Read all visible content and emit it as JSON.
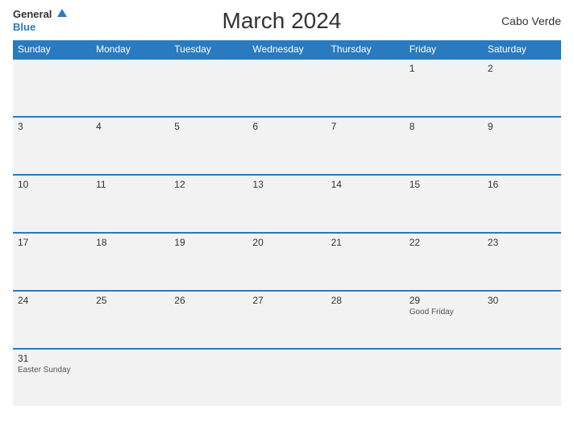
{
  "logo": {
    "general": "General",
    "blue": "Blue"
  },
  "title": "March 2024",
  "country": "Cabo Verde",
  "days": [
    "Sunday",
    "Monday",
    "Tuesday",
    "Wednesday",
    "Thursday",
    "Friday",
    "Saturday"
  ],
  "weeks": [
    [
      {
        "day": "",
        "event": ""
      },
      {
        "day": "",
        "event": ""
      },
      {
        "day": "",
        "event": ""
      },
      {
        "day": "",
        "event": ""
      },
      {
        "day": "",
        "event": ""
      },
      {
        "day": "1",
        "event": ""
      },
      {
        "day": "2",
        "event": ""
      }
    ],
    [
      {
        "day": "3",
        "event": ""
      },
      {
        "day": "4",
        "event": ""
      },
      {
        "day": "5",
        "event": ""
      },
      {
        "day": "6",
        "event": ""
      },
      {
        "day": "7",
        "event": ""
      },
      {
        "day": "8",
        "event": ""
      },
      {
        "day": "9",
        "event": ""
      }
    ],
    [
      {
        "day": "10",
        "event": ""
      },
      {
        "day": "11",
        "event": ""
      },
      {
        "day": "12",
        "event": ""
      },
      {
        "day": "13",
        "event": ""
      },
      {
        "day": "14",
        "event": ""
      },
      {
        "day": "15",
        "event": ""
      },
      {
        "day": "16",
        "event": ""
      }
    ],
    [
      {
        "day": "17",
        "event": ""
      },
      {
        "day": "18",
        "event": ""
      },
      {
        "day": "19",
        "event": ""
      },
      {
        "day": "20",
        "event": ""
      },
      {
        "day": "21",
        "event": ""
      },
      {
        "day": "22",
        "event": ""
      },
      {
        "day": "23",
        "event": ""
      }
    ],
    [
      {
        "day": "24",
        "event": ""
      },
      {
        "day": "25",
        "event": ""
      },
      {
        "day": "26",
        "event": ""
      },
      {
        "day": "27",
        "event": ""
      },
      {
        "day": "28",
        "event": ""
      },
      {
        "day": "29",
        "event": "Good Friday"
      },
      {
        "day": "30",
        "event": ""
      }
    ],
    [
      {
        "day": "31",
        "event": "Easter Sunday"
      },
      {
        "day": "",
        "event": ""
      },
      {
        "day": "",
        "event": ""
      },
      {
        "day": "",
        "event": ""
      },
      {
        "day": "",
        "event": ""
      },
      {
        "day": "",
        "event": ""
      },
      {
        "day": "",
        "event": ""
      }
    ]
  ],
  "accent_color": "#2a7abf"
}
